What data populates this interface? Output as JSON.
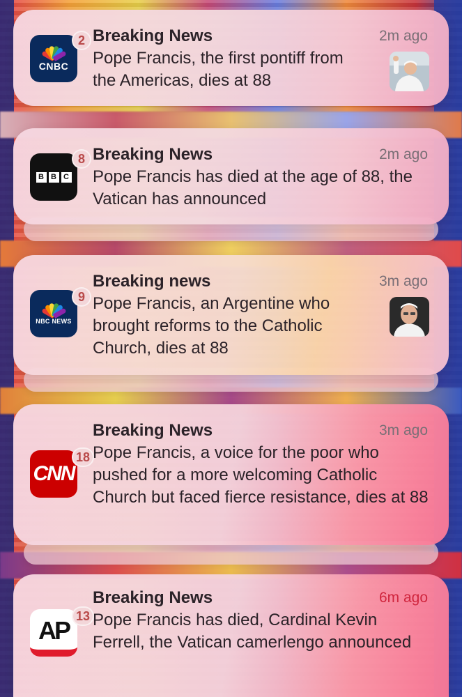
{
  "notifications": [
    {
      "app": "CNBC",
      "app_icon_text": "CNBC",
      "badge": "2",
      "title": "Breaking News",
      "time": "2m ago",
      "body": "Pope Francis, the first pontiff from the Americas, dies at 88",
      "thumbnail": "pope-waving-photo"
    },
    {
      "app": "BBC",
      "app_icon_text": [
        "B",
        "B",
        "C"
      ],
      "badge": "8",
      "title": "Breaking News",
      "time": "2m ago",
      "body": "Pope Francis has died at the age of 88, the Vatican has announced"
    },
    {
      "app": "NBC News",
      "app_icon_text": "NBC NEWS",
      "badge": "9",
      "title": "Breaking news",
      "time": "3m ago",
      "body": "Pope Francis, an Argentine who brought reforms to the Catholic Church, dies at 88",
      "thumbnail": "pope-portrait-photo"
    },
    {
      "app": "CNN",
      "app_icon_text": "CNN",
      "badge": "18",
      "title": "Breaking News",
      "time": "3m ago",
      "body": "Pope Francis, a voice for the poor who pushed for a more welcoming Catholic Church but faced fierce resistance, dies at 88"
    },
    {
      "app": "AP",
      "app_icon_text": "AP",
      "badge": "13",
      "title": "Breaking News",
      "time": "6m ago",
      "body": "Pope Francis has died, Cardinal Kevin Ferrell, the Vatican camerlengo announced"
    }
  ],
  "colors": {
    "badge_text": "#b94a4a",
    "title": "#2b2228",
    "time": "#7a6f76",
    "cnbc_bg": "#0a2a5c",
    "cnn_red": "#cc0000",
    "ap_red": "#e01b2c"
  }
}
